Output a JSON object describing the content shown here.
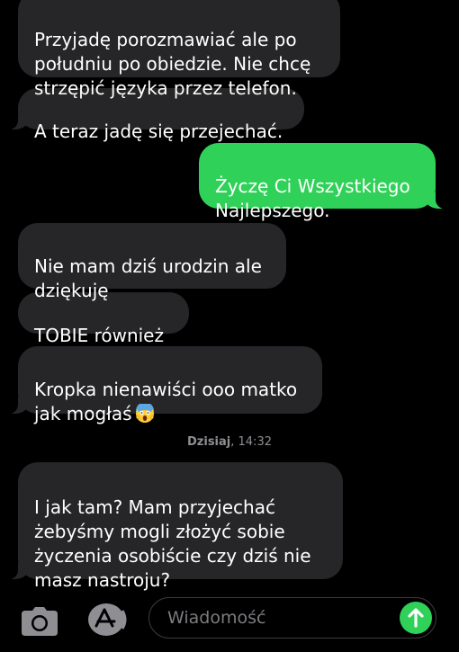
{
  "messages": [
    {
      "side": "incoming",
      "text": "Przyjadę porozmawiać ale po\npołudniu po obiedzie. Nie chcę\nstrzępić języka przez telefon."
    },
    {
      "side": "incoming",
      "text": "A teraz jadę się przejechać."
    },
    {
      "side": "outgoing",
      "text": "Życzę Ci Wszystkiego\nNajlepszego."
    },
    {
      "side": "incoming",
      "text": "Nie mam dziś urodzin ale\ndziękuję"
    },
    {
      "side": "incoming",
      "text": "TOBIE również"
    },
    {
      "side": "incoming",
      "text": "Kropka nienawiści ooo matko\njak mogłaś",
      "emoji": "screaming-face-emoji"
    },
    {
      "side": "incoming",
      "text": "I jak tam? Mam przyjechać\nżebyśmy mogli złożyć sobie\nżyczenia osobiście czy dziś nie\nmasz nastroju?"
    }
  ],
  "timestamp": {
    "day": "Dzisiaj",
    "time": "14:32"
  },
  "composer": {
    "placeholder": "Wiadomość",
    "camera_icon": "camera-icon",
    "apps_icon": "app-store-icon",
    "send_icon": "arrow-up-icon"
  },
  "colors": {
    "incoming": "#262628",
    "outgoing": "#30d158",
    "background": "#000000"
  }
}
